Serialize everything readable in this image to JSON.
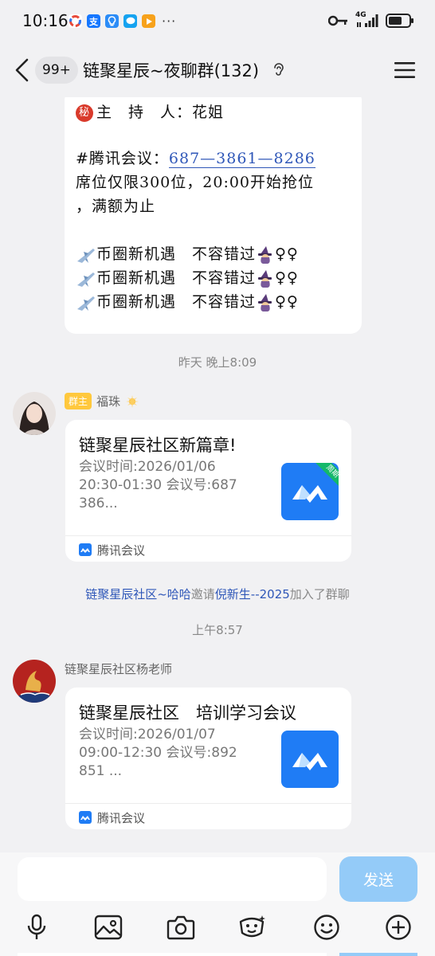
{
  "status": {
    "time": "10:16",
    "app_icon_labels": [
      "",
      "支",
      "",
      "",
      ""
    ],
    "app_icon_colors": [
      "#ffffff",
      "#1677ff",
      "#2b8cf7",
      "#16a3f0",
      "#f7a21b"
    ],
    "more": "···",
    "network": "4G"
  },
  "header": {
    "unread_count": "99+",
    "title": "链聚星辰~夜聊群(132)"
  },
  "text_message": {
    "secret_icon": "秘",
    "host_line": "主　持　人：花姐",
    "meeting_prefix": "#腾讯会议：",
    "meeting_number": "687—3861—8286",
    "seat_line1": "席位仅限300位，20:00开始抢位",
    "seat_line2": "，满额为止",
    "promo_text": "币圈新机遇　不容错过",
    "promo_suffix": "♀♀"
  },
  "separators": {
    "yesterday": "昨天 晚上8:09",
    "morning": "上午8:57"
  },
  "message1": {
    "role": "群主",
    "sender": "福珠",
    "card": {
      "title": "链聚星辰社区新篇章!",
      "desc_lines": [
        "会议时间:2026/01/06",
        "20:30-01:30  会议号:687",
        "386..."
      ],
      "thumb_tag": "周期",
      "source": "腾讯会议"
    }
  },
  "system_message": {
    "inviter": "链聚星辰社区~哈哈",
    "verb": "邀请",
    "invitee": "倪新生--2025",
    "suffix": "加入了群聊"
  },
  "message2": {
    "sender": "链聚星辰社区杨老师",
    "card": {
      "title": "链聚星辰社区　培训学习会议",
      "desc_lines": [
        "会议时间:2026/01/07",
        "09:00-12:30 会议号:892",
        "851 ..."
      ],
      "source": "腾讯会议"
    }
  },
  "input": {
    "value": "",
    "send_label": "发送"
  },
  "toolbar_icons": [
    "microphone-icon",
    "image-icon",
    "camera-icon",
    "sticker-icon",
    "emoji-icon",
    "plus-icon"
  ]
}
